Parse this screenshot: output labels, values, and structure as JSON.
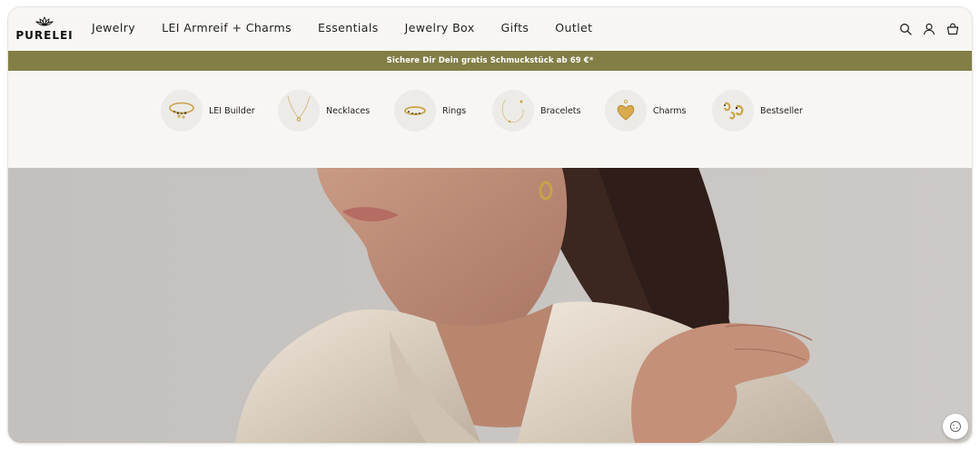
{
  "brand": {
    "name": "PURELEI"
  },
  "nav": {
    "items": [
      {
        "label": "Jewelry"
      },
      {
        "label": "LEI Armreif + Charms"
      },
      {
        "label": "Essentials"
      },
      {
        "label": "Jewelry Box"
      },
      {
        "label": "Gifts"
      },
      {
        "label": "Outlet"
      }
    ]
  },
  "header_icons": [
    "search-icon",
    "account-icon",
    "cart-icon"
  ],
  "promo": {
    "text": "Sichere Dir Dein gratis Schmuckstück ab 69 €*"
  },
  "categories": [
    {
      "label": "LEI Builder",
      "icon": "bracelet-charms-icon"
    },
    {
      "label": "Necklaces",
      "icon": "necklace-icon"
    },
    {
      "label": "Rings",
      "icon": "ring-icon"
    },
    {
      "label": "Bracelets",
      "icon": "bracelet-icon"
    },
    {
      "label": "Charms",
      "icon": "heart-charm-icon"
    },
    {
      "label": "Bestseller",
      "icon": "earrings-icon"
    }
  ],
  "hero": {
    "alt": ""
  },
  "cookie_widget": {
    "icon": "cookie-settings-icon"
  },
  "colors": {
    "promo_bar": "#827e46",
    "background": "#f7f6f3",
    "text": "#222222"
  }
}
